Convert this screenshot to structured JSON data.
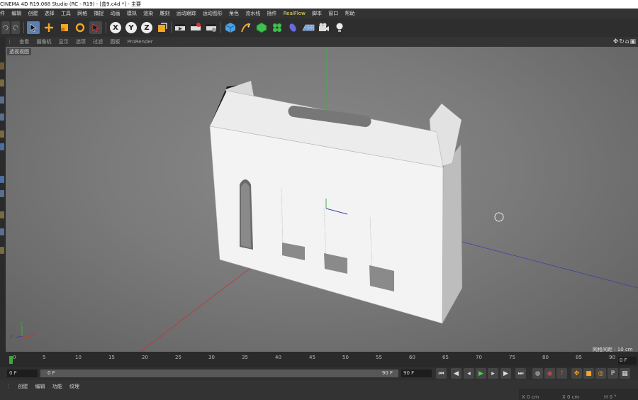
{
  "window": {
    "title": "CINEMA 4D R19.068 Studio (RC - R19) - [盒9.c4d *] - 主要"
  },
  "menu": {
    "first": "件",
    "items": [
      "编辑",
      "创建",
      "选择",
      "工具",
      "网格",
      "捕捉",
      "动画",
      "模拟",
      "渲染",
      "雕刻",
      "运动跟踪",
      "运动图形",
      "角色",
      "流水线",
      "插件"
    ],
    "realflow": "RealFlow",
    "items_after": [
      "脚本",
      "窗口",
      "帮助"
    ]
  },
  "toolbar": {
    "axis_x": "X",
    "axis_y": "Y",
    "axis_z": "Z"
  },
  "viewport": {
    "menu": [
      "查看",
      "摄像机",
      "显示",
      "选项",
      "过滤",
      "面板",
      "ProRender"
    ],
    "view_name": "透视视图",
    "grid_spacing": "网格间距 : 10 cm",
    "axis_y_label": "Y",
    "axis_x_label": "X",
    "axis_z_label": "Z"
  },
  "timeline": {
    "ticks": [
      "0",
      "5",
      "10",
      "15",
      "20",
      "25",
      "30",
      "35",
      "40",
      "45",
      "50",
      "55",
      "60",
      "65",
      "70",
      "75",
      "80",
      "85",
      "90"
    ],
    "end_frame_box": "0 F"
  },
  "transport": {
    "current_frame": "0 F",
    "range_start": "0 F",
    "range_end": "90 F",
    "end_frame": "90 F"
  },
  "bottom": {
    "menu": [
      "创建",
      "编辑",
      "功能",
      "纹理"
    ],
    "coords": {
      "x": "X   0 cm",
      "x2": "X   0 cm",
      "h": "H   0 °"
    }
  },
  "colors": {
    "grid_x_axis": "#c0363a",
    "grid_z_axis": "#3a3fb0",
    "grid_y_axis": "#3cb43c",
    "selection": "#5b7fb3",
    "realflow": "#f2e36b"
  }
}
